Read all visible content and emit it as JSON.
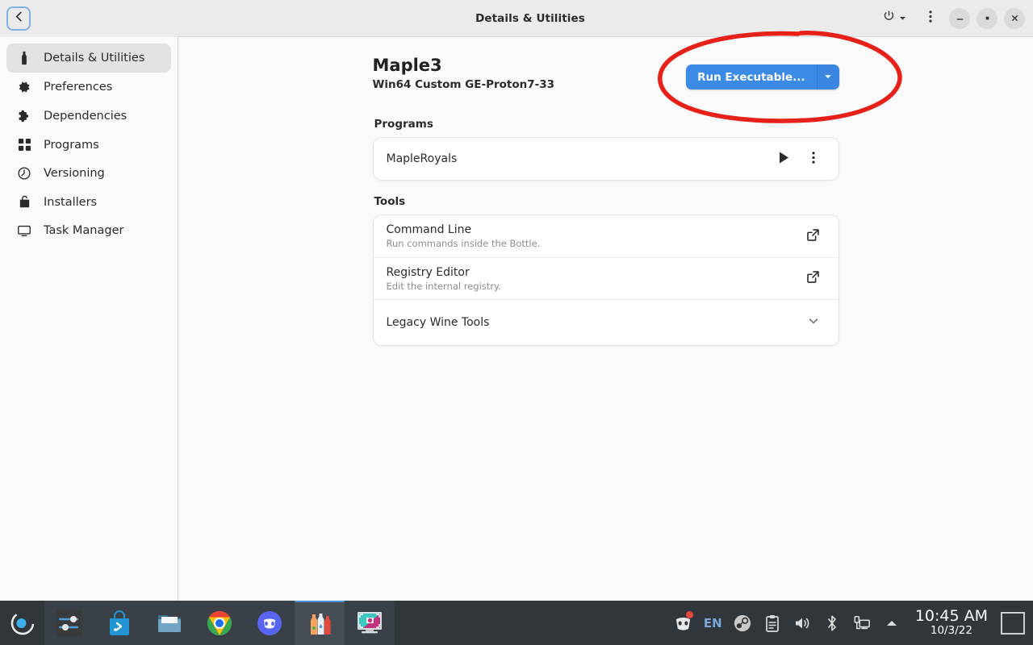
{
  "window": {
    "title": "Details & Utilities",
    "back_icon": "chevron-left-icon",
    "power_icon": "power-icon",
    "power_chevron_icon": "chevron-down-icon",
    "menu_icon": "kebab-menu-icon",
    "minimize_label": "−",
    "maximize_label": "▫",
    "close_label": "✕"
  },
  "sidebar": {
    "items": [
      {
        "label": "Details & Utilities",
        "icon": "bottle-icon",
        "active": true
      },
      {
        "label": "Preferences",
        "icon": "gear-icon",
        "active": false
      },
      {
        "label": "Dependencies",
        "icon": "puzzle-icon",
        "active": false
      },
      {
        "label": "Programs",
        "icon": "grid-icon",
        "active": false
      },
      {
        "label": "Versioning",
        "icon": "clock-back-icon",
        "active": false
      },
      {
        "label": "Installers",
        "icon": "bag-icon",
        "active": false
      },
      {
        "label": "Task Manager",
        "icon": "monitor-icon",
        "active": false
      }
    ]
  },
  "main": {
    "bottle_name": "Maple3",
    "bottle_subtitle": "Win64 Custom GE-Proton7-33",
    "run_button": {
      "label": "Run Executable...",
      "dropdown_icon": "caret-down-icon",
      "color": "#3b8ae5"
    },
    "programs_heading": "Programs",
    "programs": [
      {
        "name": "MapleRoyals",
        "play_icon": "play-icon",
        "menu_icon": "kebab-menu-icon"
      }
    ],
    "tools_heading": "Tools",
    "tools": [
      {
        "title": "Command Line",
        "subtitle": "Run commands inside the Bottle.",
        "icon": "external-link-icon"
      },
      {
        "title": "Registry Editor",
        "subtitle": "Edit the internal registry.",
        "icon": "external-link-icon"
      },
      {
        "title": "Legacy Wine Tools",
        "subtitle": "",
        "icon": "chevron-down-icon"
      }
    ]
  },
  "annotation": {
    "shape": "hand-drawn-ellipse",
    "color": "#e8201a",
    "target": "Run Executable... button"
  },
  "taskbar": {
    "launcher": {
      "icon": "kde-launcher-icon"
    },
    "tasks": [
      {
        "icon": "system-settings-icon",
        "state": "dim"
      },
      {
        "icon": "discover-store-icon",
        "state": "dim"
      },
      {
        "icon": "file-manager-icon",
        "state": "dim"
      },
      {
        "icon": "chrome-icon",
        "state": "dim"
      },
      {
        "icon": "discord-icon",
        "state": "dim"
      },
      {
        "icon": "bottles-icon",
        "state": "act"
      },
      {
        "icon": "spectacle-icon",
        "state": "dim"
      }
    ],
    "tray": [
      {
        "icon": "discord-tray-icon",
        "badge": true
      },
      {
        "icon": "keyboard-layout",
        "label": "EN"
      },
      {
        "icon": "steam-icon"
      },
      {
        "icon": "clipboard-icon"
      },
      {
        "icon": "volume-icon"
      },
      {
        "icon": "bluetooth-icon"
      },
      {
        "icon": "network-icon"
      },
      {
        "icon": "show-hidden-icon"
      }
    ],
    "clock_time": "10:45 AM",
    "clock_date": "10/3/22",
    "show_desktop_icon": "show-desktop-icon"
  }
}
